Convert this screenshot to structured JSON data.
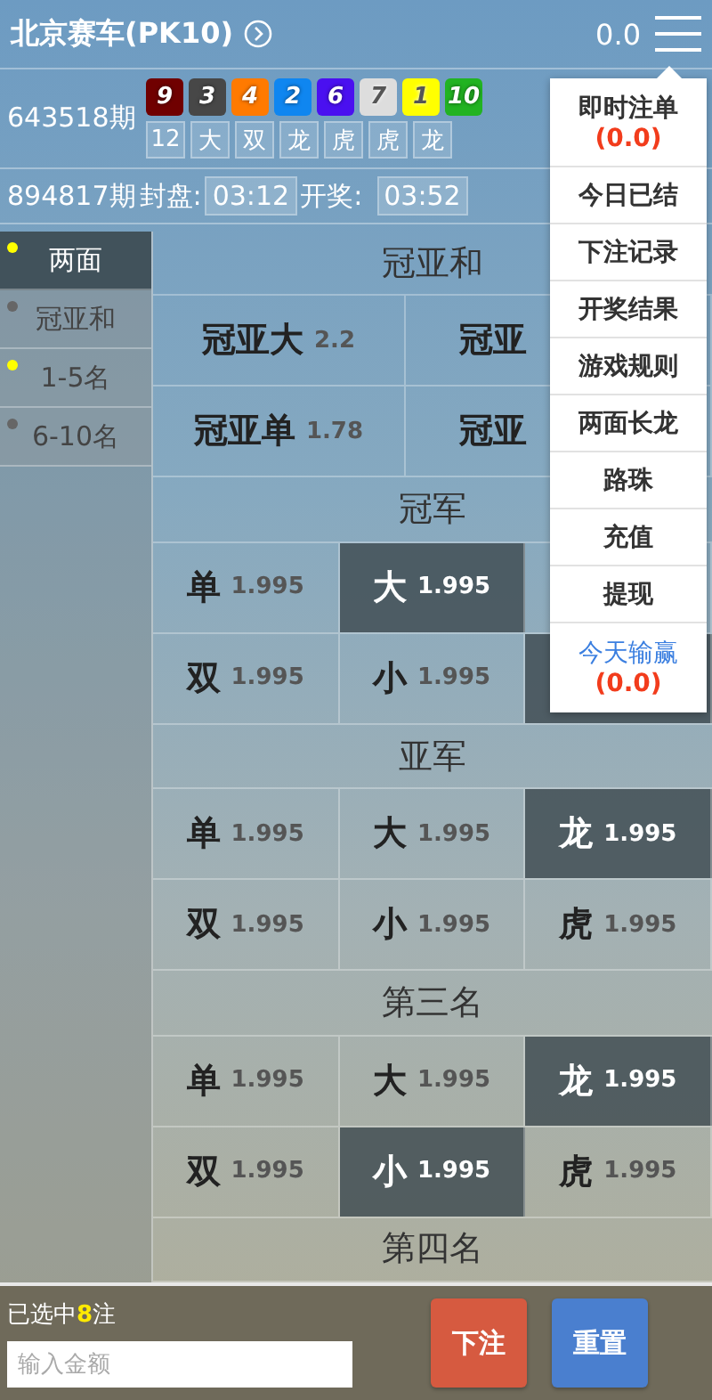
{
  "header": {
    "title": "北京赛车(PK10)",
    "balance": "0.0"
  },
  "last_draw": {
    "issue": "643518期",
    "balls": [
      {
        "number": "9",
        "color": "#700000"
      },
      {
        "number": "3",
        "color": "#474747"
      },
      {
        "number": "4",
        "color": "#ff7a00"
      },
      {
        "number": "2",
        "color": "#0f86f0"
      },
      {
        "number": "6",
        "color": "#4a10f0"
      },
      {
        "number": "7",
        "color": "#dddddd"
      },
      {
        "number": "1",
        "color": "#ffff00"
      },
      {
        "number": "10",
        "color": "#22b322"
      }
    ],
    "results": [
      "12",
      "大",
      "双",
      "龙",
      "虎",
      "虎",
      "龙"
    ]
  },
  "next_draw": {
    "issue": "894817期",
    "close_label": "封盘:",
    "close_time": "03:12",
    "open_label": "开奖:",
    "open_time": "03:52"
  },
  "sidebar": {
    "items": [
      {
        "label": "两面",
        "selected": true,
        "color": "#ffff00"
      },
      {
        "label": "冠亚和",
        "selected": false,
        "color": "#666666"
      },
      {
        "label": "1-5名",
        "selected": false,
        "color": "#ffff00"
      },
      {
        "label": "6-10名",
        "selected": false,
        "color": "#666666"
      }
    ]
  },
  "sections": [
    {
      "title": "冠亚和",
      "rows": [
        [
          {
            "label": "冠亚大",
            "odds": "2.2",
            "selected": false
          },
          {
            "label": "冠亚",
            "selected": false
          }
        ],
        [
          {
            "label": "冠亚单",
            "odds": "1.78",
            "selected": false
          },
          {
            "label": "冠亚",
            "selected": false
          }
        ]
      ]
    },
    {
      "title": "冠军",
      "rows": [
        [
          {
            "label": "单",
            "odds": "1.995",
            "selected": false
          },
          {
            "label": "大",
            "odds": "1.995",
            "selected": true
          },
          {
            "selected": false
          }
        ],
        [
          {
            "label": "双",
            "odds": "1.995",
            "selected": false
          },
          {
            "label": "小",
            "odds": "1.995",
            "selected": false
          },
          {
            "selected": true
          }
        ]
      ]
    },
    {
      "title": "亚军",
      "rows": [
        [
          {
            "label": "单",
            "odds": "1.995",
            "selected": false
          },
          {
            "label": "大",
            "odds": "1.995",
            "selected": false
          },
          {
            "label": "龙",
            "odds": "1.995",
            "selected": true
          }
        ],
        [
          {
            "label": "双",
            "odds": "1.995",
            "selected": false
          },
          {
            "label": "小",
            "odds": "1.995",
            "selected": false
          },
          {
            "label": "虎",
            "odds": "1.995",
            "selected": false
          }
        ]
      ]
    },
    {
      "title": "第三名",
      "rows": [
        [
          {
            "label": "单",
            "odds": "1.995",
            "selected": false
          },
          {
            "label": "大",
            "odds": "1.995",
            "selected": false
          },
          {
            "label": "龙",
            "odds": "1.995",
            "selected": true
          }
        ],
        [
          {
            "label": "双",
            "odds": "1.995",
            "selected": false
          },
          {
            "label": "小",
            "odds": "1.995",
            "selected": true
          },
          {
            "label": "虎",
            "odds": "1.995",
            "selected": false
          }
        ]
      ]
    },
    {
      "title": "第四名"
    }
  ],
  "menu": {
    "items": [
      {
        "label": "即时注单",
        "amount": "(0.0)",
        "kind": "plain"
      },
      {
        "label": "今日已结",
        "kind": "plain"
      },
      {
        "label": "下注记录",
        "kind": "plain"
      },
      {
        "label": "开奖结果",
        "kind": "plain"
      },
      {
        "label": "游戏规则",
        "kind": "plain"
      },
      {
        "label": "两面长龙",
        "kind": "plain"
      },
      {
        "label": "路珠",
        "kind": "plain"
      },
      {
        "label": "充值",
        "kind": "plain"
      },
      {
        "label": "提现",
        "kind": "plain"
      },
      {
        "label": "今天输赢",
        "amount": "(0.0)",
        "kind": "link"
      }
    ]
  },
  "footer": {
    "selection": "已选中**8**注",
    "amount_placeholder": "输入金额",
    "buttons": [
      {
        "label": "下注",
        "kind": "submit"
      },
      {
        "label": "重置",
        "kind": "reset"
      }
    ]
  }
}
